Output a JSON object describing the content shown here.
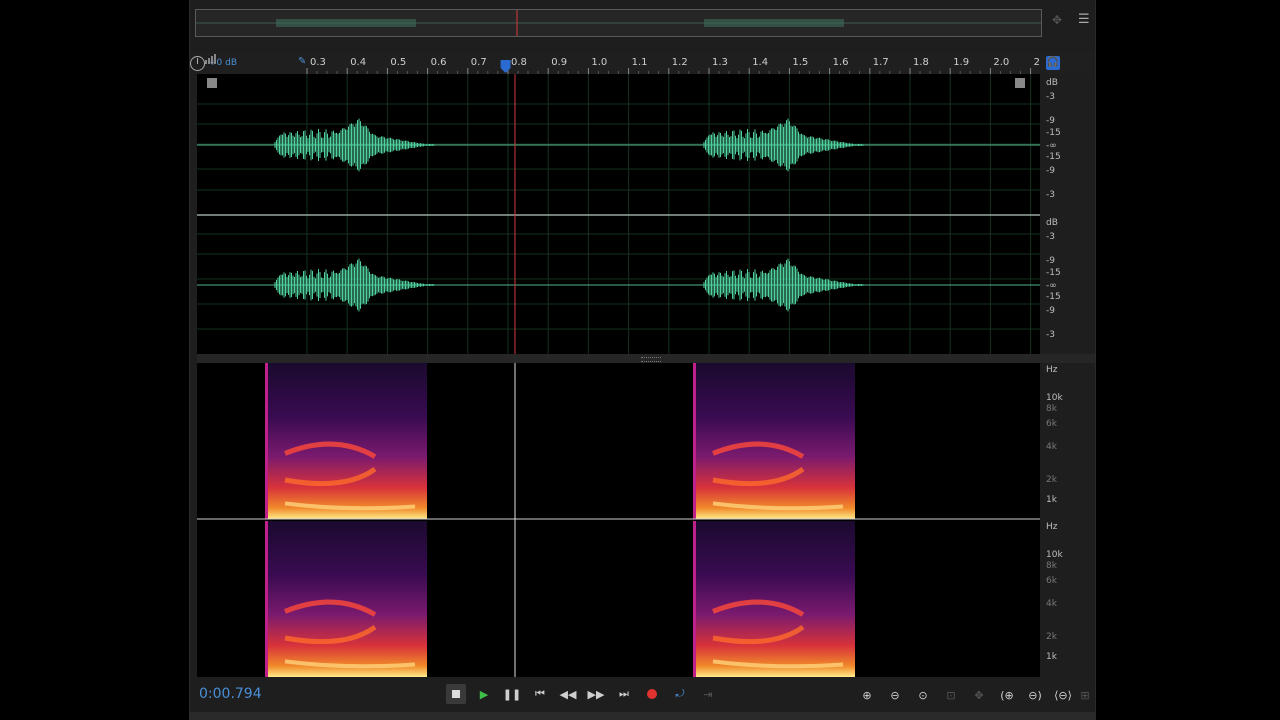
{
  "app": {
    "accent": "#4a8fd6",
    "waveform_color": "#4fd2a0",
    "playhead_color": "#d13b3b"
  },
  "toolbar": {
    "gain_label": "+0 dB"
  },
  "ruler": {
    "ticks": [
      "0.3",
      "0.4",
      "0.5",
      "0.6",
      "0.7",
      "0.8",
      "0.9",
      "1.0",
      "1.1",
      "1.2",
      "1.3",
      "1.4",
      "1.5",
      "1.6",
      "1.7",
      "1.8",
      "1.9",
      "2.0",
      "2"
    ],
    "playhead_time": 0.794
  },
  "amplitude_scale": {
    "channel1": [
      "dB",
      "-3",
      "-9",
      "-15",
      "-∞",
      "-15",
      "-9",
      "-3"
    ],
    "channel2": [
      "dB",
      "-3",
      "-9",
      "-15",
      "-∞",
      "-15",
      "-9",
      "-3"
    ]
  },
  "frequency_scale": {
    "channel1": [
      "Hz",
      "10k",
      "8k",
      "6k",
      "4k",
      "2k",
      "1k"
    ],
    "channel2": [
      "Hz",
      "10k",
      "8k",
      "6k",
      "4k",
      "2k",
      "1k"
    ]
  },
  "transport": {
    "time": "0:00.794",
    "buttons": [
      "stop-icon",
      "play-icon",
      "pause-icon",
      "skip-start-icon",
      "rewind-icon",
      "fast-forward-icon",
      "skip-end-icon",
      "record-icon",
      "loop-icon",
      "skip-selection-icon"
    ]
  },
  "zoom_buttons": [
    "zoom-in-amplitude-icon",
    "zoom-out-amplitude-icon",
    "zoom-reset-icon",
    "zoom-selection-icon",
    "zoom-full-icon",
    "zoom-in-time-icon",
    "zoom-out-time-icon",
    "zoom-out-full-icon"
  ]
}
